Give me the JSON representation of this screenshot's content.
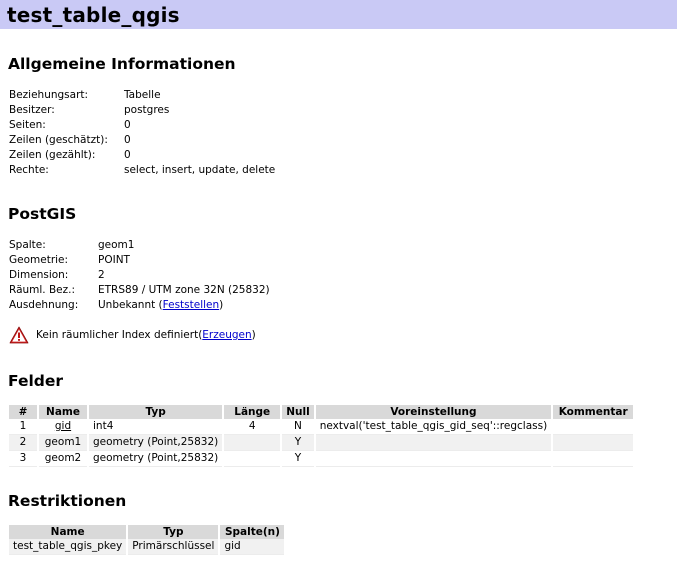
{
  "page": {
    "title": "test_table_qgis"
  },
  "general": {
    "heading": "Allgemeine Informationen",
    "rows": [
      {
        "key": "Beziehungsart:",
        "value": "Tabelle"
      },
      {
        "key": "Besitzer:",
        "value": "postgres"
      },
      {
        "key": "Seiten:",
        "value": "0"
      },
      {
        "key": "Zeilen (geschätzt):",
        "value": "0"
      },
      {
        "key": "Zeilen (gezählt):",
        "value": "0"
      },
      {
        "key": "Rechte:",
        "value": "select, insert, update, delete"
      }
    ]
  },
  "postgis": {
    "heading": "PostGIS",
    "rows": [
      {
        "key": "Spalte:",
        "value": "geom1"
      },
      {
        "key": "Geometrie:",
        "value": "POINT"
      },
      {
        "key": "Dimension:",
        "value": "2"
      },
      {
        "key": "Räuml. Bez.:",
        "value": "ETRS89 / UTM zone 32N (25832)"
      },
      {
        "key": "Ausdehnung:",
        "value": "Unbekannt (",
        "link": "Feststellen",
        "suffix": ")"
      }
    ],
    "warning": {
      "text": "Kein räumlicher Index definiert(",
      "link": "Erzeugen",
      "suffix": ")",
      "icon": "warning-icon"
    }
  },
  "fields": {
    "heading": "Felder",
    "columns": [
      "#",
      "Name",
      "Typ",
      "Länge",
      "Null",
      "Voreinstellung",
      "Kommentar"
    ],
    "rows": [
      [
        "1",
        "gid",
        "int4",
        "4",
        "N",
        "nextval('test_table_qgis_gid_seq'::regclass)",
        ""
      ],
      [
        "2",
        "geom1",
        "geometry (Point,25832)",
        "",
        "Y",
        "",
        ""
      ],
      [
        "3",
        "geom2",
        "geometry (Point,25832)",
        "",
        "Y",
        "",
        ""
      ]
    ]
  },
  "constraints": {
    "heading": "Restriktionen",
    "columns": [
      "Name",
      "Typ",
      "Spalte(n)"
    ],
    "rows": [
      [
        "test_table_qgis_pkey",
        "Primärschlüssel",
        "gid"
      ]
    ]
  }
}
